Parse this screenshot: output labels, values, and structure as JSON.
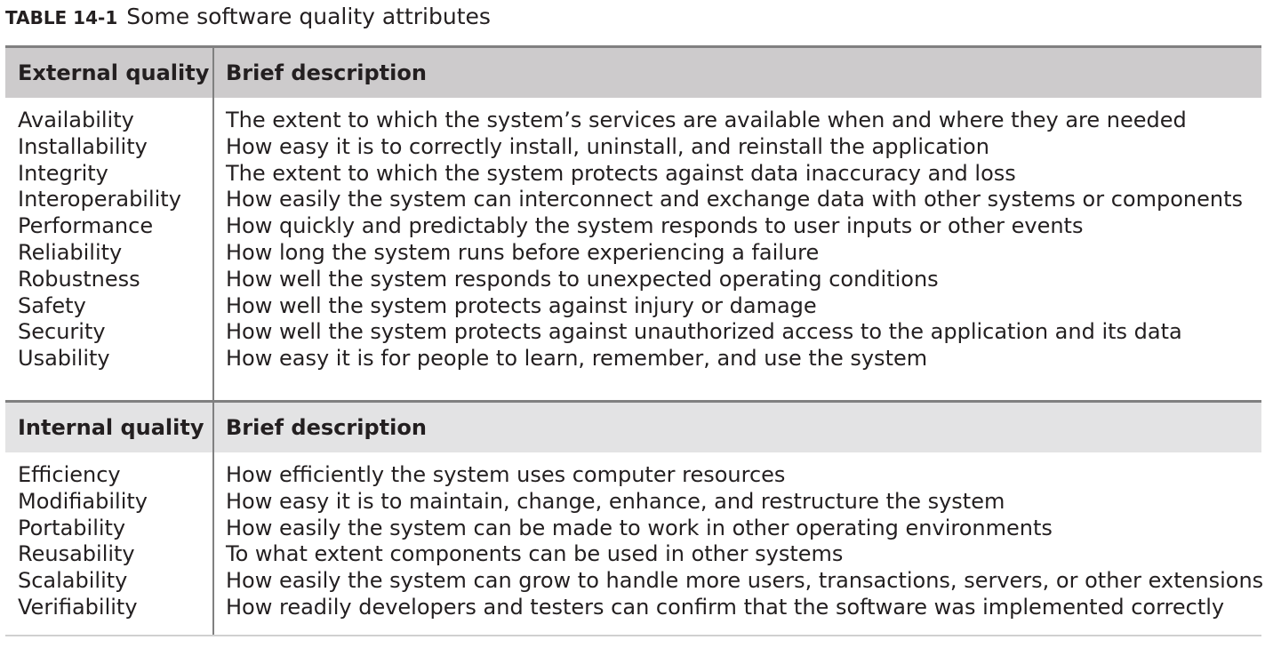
{
  "caption": {
    "number": "TABLE 14-1",
    "title": "Some software quality attributes"
  },
  "sections": [
    {
      "header": {
        "col1": "External quality",
        "col2": "Brief description"
      },
      "rows": [
        {
          "name": "Availability",
          "description": "The extent to which the system’s services are available when and where they are needed"
        },
        {
          "name": "Installability",
          "description": "How easy it is to correctly install, uninstall, and reinstall the application"
        },
        {
          "name": "Integrity",
          "description": "The extent to which the system protects against data inaccuracy and loss"
        },
        {
          "name": "Interoperability",
          "description": "How easily the system can interconnect and exchange data with other systems or components"
        },
        {
          "name": "Performance",
          "description": "How quickly and predictably the system responds to user inputs or other events"
        },
        {
          "name": "Reliability",
          "description": "How long the system runs before experiencing a failure"
        },
        {
          "name": "Robustness",
          "description": "How well the system responds to unexpected operating conditions"
        },
        {
          "name": "Safety",
          "description": "How well the system protects against injury or damage"
        },
        {
          "name": "Security",
          "description": "How well the system protects against unauthorized access to the application and its data"
        },
        {
          "name": "Usability",
          "description": "How easy it is for people to learn, remember, and use the system"
        }
      ]
    },
    {
      "header": {
        "col1": "Internal quality",
        "col2": "Brief description"
      },
      "rows": [
        {
          "name": "Efficiency",
          "description": "How efficiently the system uses computer resources"
        },
        {
          "name": "Modifiability",
          "description": "How easy it is to maintain, change, enhance, and restructure the system"
        },
        {
          "name": "Portability",
          "description": "How easily the system can be made to work in other operating environments"
        },
        {
          "name": "Reusability",
          "description": "To what extent components can be used in other systems"
        },
        {
          "name": "Scalability",
          "description": "How easily the system can grow to handle more users, transactions, servers, or other extensions"
        },
        {
          "name": "Verifiability",
          "description": "How readily developers and testers can confirm that the software was implemented correctly"
        }
      ]
    }
  ],
  "colors": {
    "header_band_1": "#cdcbcc",
    "header_band_2": "#e3e3e4",
    "rule": "#808080",
    "text": "#231f20"
  }
}
